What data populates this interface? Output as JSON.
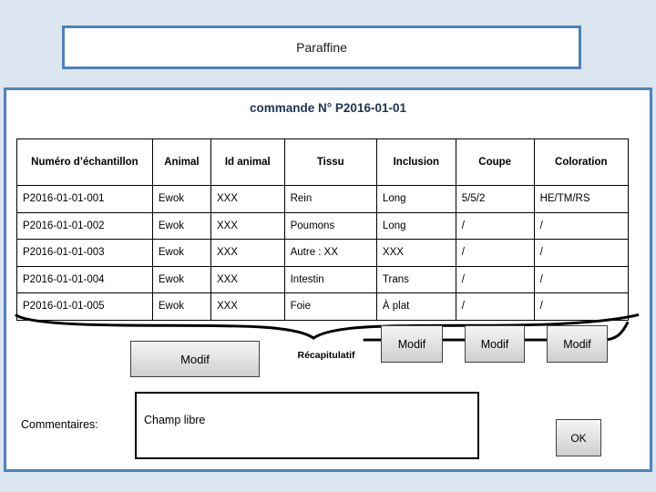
{
  "colors": {
    "page_background": "#dce6f1",
    "panel_border": "#4f81bd",
    "panel_background": "#ffffff",
    "table_border": "#000000",
    "order_title_text": "#1f3356",
    "button_face": "#e8e8e8"
  },
  "title_box": {
    "text": "Paraffine"
  },
  "main": {
    "order_title": "commande N° P2016-01-01",
    "recap_label": "Récapitulatif",
    "comments_label": "Commentaires:",
    "comments_value": "Champ libre",
    "ok_label": "OK"
  },
  "table": {
    "columns": [
      "Numéro d’échantillon",
      "Animal",
      "Id animal",
      "Tissu",
      "Inclusion",
      "Coupe",
      "Coloration"
    ],
    "rows": [
      {
        "numero": "P2016-01-01-001",
        "animal": "Ewok",
        "id_animal": "XXX",
        "tissu": "Rein",
        "inclusion": "Long",
        "coupe": "5/5/2",
        "coloration": "HE/TM/RS"
      },
      {
        "numero": "P2016-01-01-002",
        "animal": "Ewok",
        "id_animal": "XXX",
        "tissu": "Poumons",
        "inclusion": "Long",
        "coupe": "/",
        "coloration": "/"
      },
      {
        "numero": "P2016-01-01-003",
        "animal": "Ewok",
        "id_animal": "XXX",
        "tissu": "Autre : XX",
        "inclusion": "XXX",
        "coupe": "/",
        "coloration": "/"
      },
      {
        "numero": "P2016-01-01-004",
        "animal": "Ewok",
        "id_animal": "XXX",
        "tissu": "Intestin",
        "inclusion": "Trans",
        "coupe": "/",
        "coloration": "/"
      },
      {
        "numero": "P2016-01-01-005",
        "animal": "Ewok",
        "id_animal": "XXX",
        "tissu": "Foie",
        "inclusion": "À plat",
        "coupe": "/",
        "coloration": "/"
      }
    ]
  },
  "buttons": {
    "modif_main": "Modif",
    "modif_1": "Modif",
    "modif_2": "Modif",
    "modif_3": "Modif"
  }
}
